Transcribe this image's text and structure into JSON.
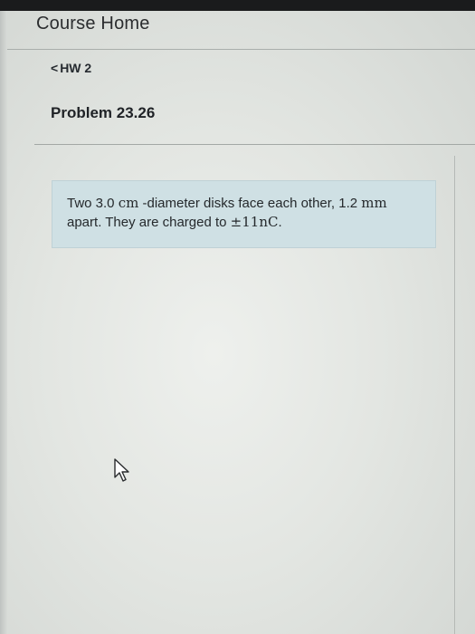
{
  "header": {
    "title": "Course Home"
  },
  "nav": {
    "back_chevron": "<",
    "back_label": "HW 2"
  },
  "problem": {
    "title": "Problem 23.26"
  },
  "question": {
    "segment_1": "Two 3.0 ",
    "unit_cm": "cm",
    "segment_2": " -diameter disks face each other, 1.2 ",
    "unit_mm": "mm",
    "segment_3": " apart. They are charged to ",
    "charge": "±11nC",
    "segment_4": "."
  },
  "icons": {
    "cursor": "arrow-pointer-icon"
  },
  "colors": {
    "question_background": "#cfe0e4",
    "bezel": "#1a1b1c"
  }
}
